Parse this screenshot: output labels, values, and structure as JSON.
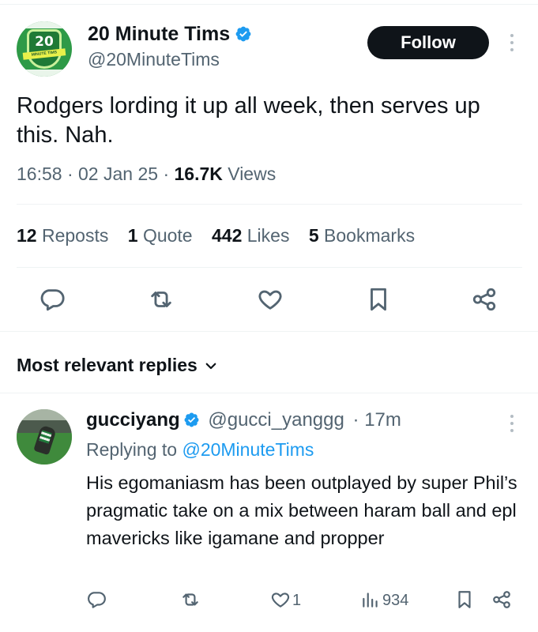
{
  "colors": {
    "text": "#0f1419",
    "secondary": "#536471",
    "accent": "#1d9bf0",
    "verified": "#1d9bf0",
    "follow_bg": "#0f1419",
    "divider": "#eff3f4",
    "avatar_green": "#2e9a47"
  },
  "tweet": {
    "author": {
      "avatar_badge_number": "20",
      "avatar_badge_ribbon": "MINUTE TIMS",
      "name": "20 Minute Tims",
      "handle": "@20MinuteTims",
      "verified_icon": "verified-badge-icon"
    },
    "follow_label": "Follow",
    "more_icon": "more-vertical-icon",
    "text": "Rodgers lording it up all week, then serves up this. Nah.",
    "time": "16:58",
    "date": "02 Jan 25",
    "views_count": "16.7K",
    "views_label": "Views",
    "stats": {
      "reposts_count": "12",
      "reposts_label": "Reposts",
      "quotes_count": "1",
      "quotes_label": "Quote",
      "likes_count": "442",
      "likes_label": "Likes",
      "bookmarks_count": "5",
      "bookmarks_label": "Bookmarks"
    },
    "actions": [
      "reply-icon",
      "repost-icon",
      "like-icon",
      "bookmark-icon",
      "share-icon"
    ]
  },
  "replies_section": {
    "sort_label": "Most relevant replies",
    "sort_icon": "chevron-down-icon"
  },
  "reply": {
    "name": "gucciyang",
    "handle": "@gucci_yanggg",
    "separator": "·",
    "time": "17m",
    "replying_prefix": "Replying to",
    "replying_to": "@20MinuteTims",
    "text": "His egomaniasm has been outplayed by super Phil’s pragmatic take on a mix between haram ball and epl mavericks like igamane and propper",
    "likes_count": "1",
    "views_count": "934",
    "actions": [
      "reply-icon",
      "repost-icon",
      "like-icon",
      "views-icon",
      "bookmark-icon",
      "share-icon"
    ]
  }
}
